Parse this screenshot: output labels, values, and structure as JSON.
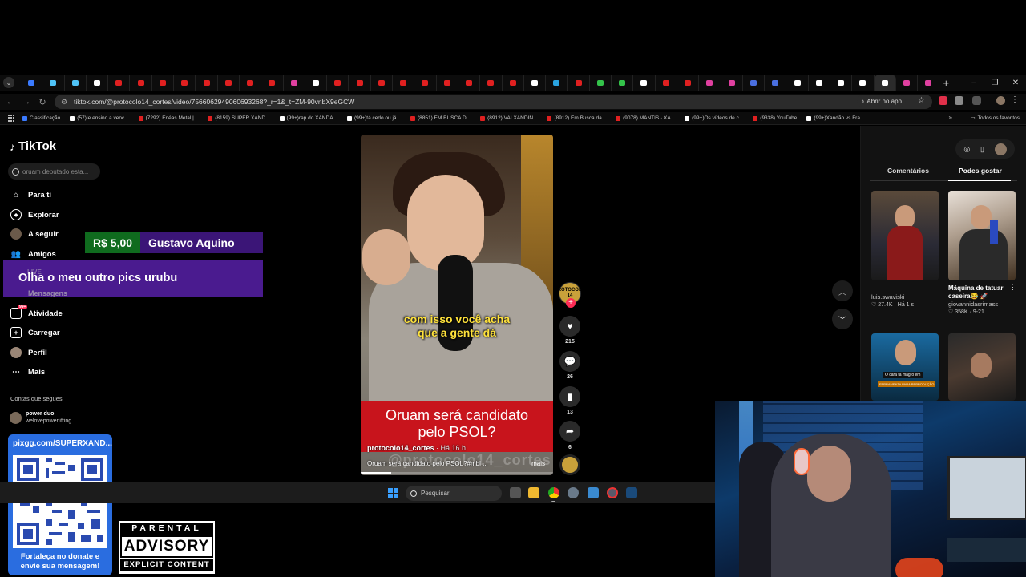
{
  "browser": {
    "tab_icon_colors": [
      "#3b7bff",
      "#4fc3f7",
      "#4fc3f7",
      "#ffffff",
      "#e02020",
      "#e02020",
      "#e02020",
      "#e02020",
      "#e02020",
      "#e02020",
      "#e02020",
      "#e02020",
      "#e040a0",
      "#ffffff",
      "#e02020",
      "#e02020",
      "#e02020",
      "#e02020",
      "#e02020",
      "#e02020",
      "#e02020",
      "#e02020",
      "#e02020",
      "#ffffff",
      "#2aa3e0",
      "#e02020",
      "#34c34a",
      "#34c34a",
      "#ffffff",
      "#e02020",
      "#e02020",
      "#e040a0",
      "#e040a0",
      "#4a6fe0",
      "#4a6fe0",
      "#ffffff",
      "#ffffff",
      "#ffffff",
      "#ffffff",
      "#ffffff",
      "#e040a0",
      "#e040a0"
    ],
    "url": "tiktok.com/@protocolo14_cortes/video/7566062949060693268?_r=1&_t=ZM-90vnbX9eGCW",
    "open_app_label": "Abrir no app",
    "bookmarks": [
      {
        "label": "Classificação",
        "color": "#3b7bff"
      },
      {
        "label": "(57)Ie ensino a venc...",
        "color": "#ffffff"
      },
      {
        "label": "(7292) Enéas Metal |...",
        "color": "#e02020"
      },
      {
        "label": "(8159) SUPER XAND...",
        "color": "#e02020"
      },
      {
        "label": "(99+)rap do XANDÃ...",
        "color": "#ffffff"
      },
      {
        "label": "(99+)tá cedo ou já...",
        "color": "#ffffff"
      },
      {
        "label": "(8851) EM BUSCA D...",
        "color": "#e02020"
      },
      {
        "label": "(8912) VAI XANDIN...",
        "color": "#e02020"
      },
      {
        "label": "(8912) Em Busca da...",
        "color": "#e02020"
      },
      {
        "label": "(9078) MANTIS · XA...",
        "color": "#e02020"
      },
      {
        "label": "(99+)Os vídeos de c...",
        "color": "#ffffff"
      },
      {
        "label": "(9338) YouTube",
        "color": "#e02020"
      },
      {
        "label": "(99+)Xandão vs Fra...",
        "color": "#ffffff"
      }
    ],
    "all_favorites_label": "Todos os favoritos"
  },
  "tiktok": {
    "logo_text": "TikTok",
    "search_placeholder": "oruam deputado esta...",
    "nav": {
      "for_you": "Para ti",
      "explore": "Explorar",
      "following": "A seguir",
      "friends": "Amigos",
      "live": "LIVE",
      "messages": "Mensagens",
      "activity": "Atividade",
      "activity_badge": "99+",
      "upload": "Carregar",
      "profile": "Perfil",
      "more": "Mais"
    },
    "following_section_title": "Contas que segues",
    "following_account": {
      "name": "power duo",
      "handle": "welovepowerlifting"
    }
  },
  "donation": {
    "amount": "R$ 5,00",
    "donor": "Gustavo Aquino",
    "message": "Olha o meu outro pics urubu"
  },
  "qr_card": {
    "url": "pixgg.com/SUPERXAND...",
    "line1": "Fortaleça no donate e",
    "line2": "envie sua mensagem!"
  },
  "parental_advisory": {
    "top": "PARENTAL",
    "middle": "ADVISORY",
    "bottom": "EXPLICIT CONTENT"
  },
  "video": {
    "caption_line1": "com isso você acha",
    "caption_line2": "que a gente dá",
    "title_line1": "Oruam será candidato",
    "title_line2": "pelo PSOL?",
    "author": "protocolo14_cortes",
    "time": "· Há 16 h",
    "watermark": "@protocolo14_cortes",
    "description": "Oruam será candidato pelo PSOL?#mbl ...",
    "more_label": "mais",
    "progress": 0.16,
    "creator_avatar_text": "PROTOCOLO 14"
  },
  "actions": {
    "likes": "215",
    "comments": "26",
    "saves": "13",
    "shares": "6"
  },
  "right_panel": {
    "tab_comments": "Comentários",
    "tab_you_may_like": "Podes gostar",
    "thumbs": [
      {
        "title": "",
        "user": "luis.swaviski",
        "views": "27.4K",
        "time": "Há 1 s"
      },
      {
        "title": "Máquina de tatuar caseira😂 🚀",
        "user": "giovannidasrimass",
        "views": "358K",
        "time": "9-21"
      },
      {
        "title": "",
        "user": "",
        "views": "",
        "time": "",
        "label_a": "O cara tá magro em",
        "label_b": "FERRAMENTA PARA REPRODUÇÃO"
      },
      {
        "title": "",
        "user": "",
        "views": "",
        "time": ""
      }
    ]
  },
  "taskbar": {
    "search_placeholder": "Pesquisar"
  }
}
